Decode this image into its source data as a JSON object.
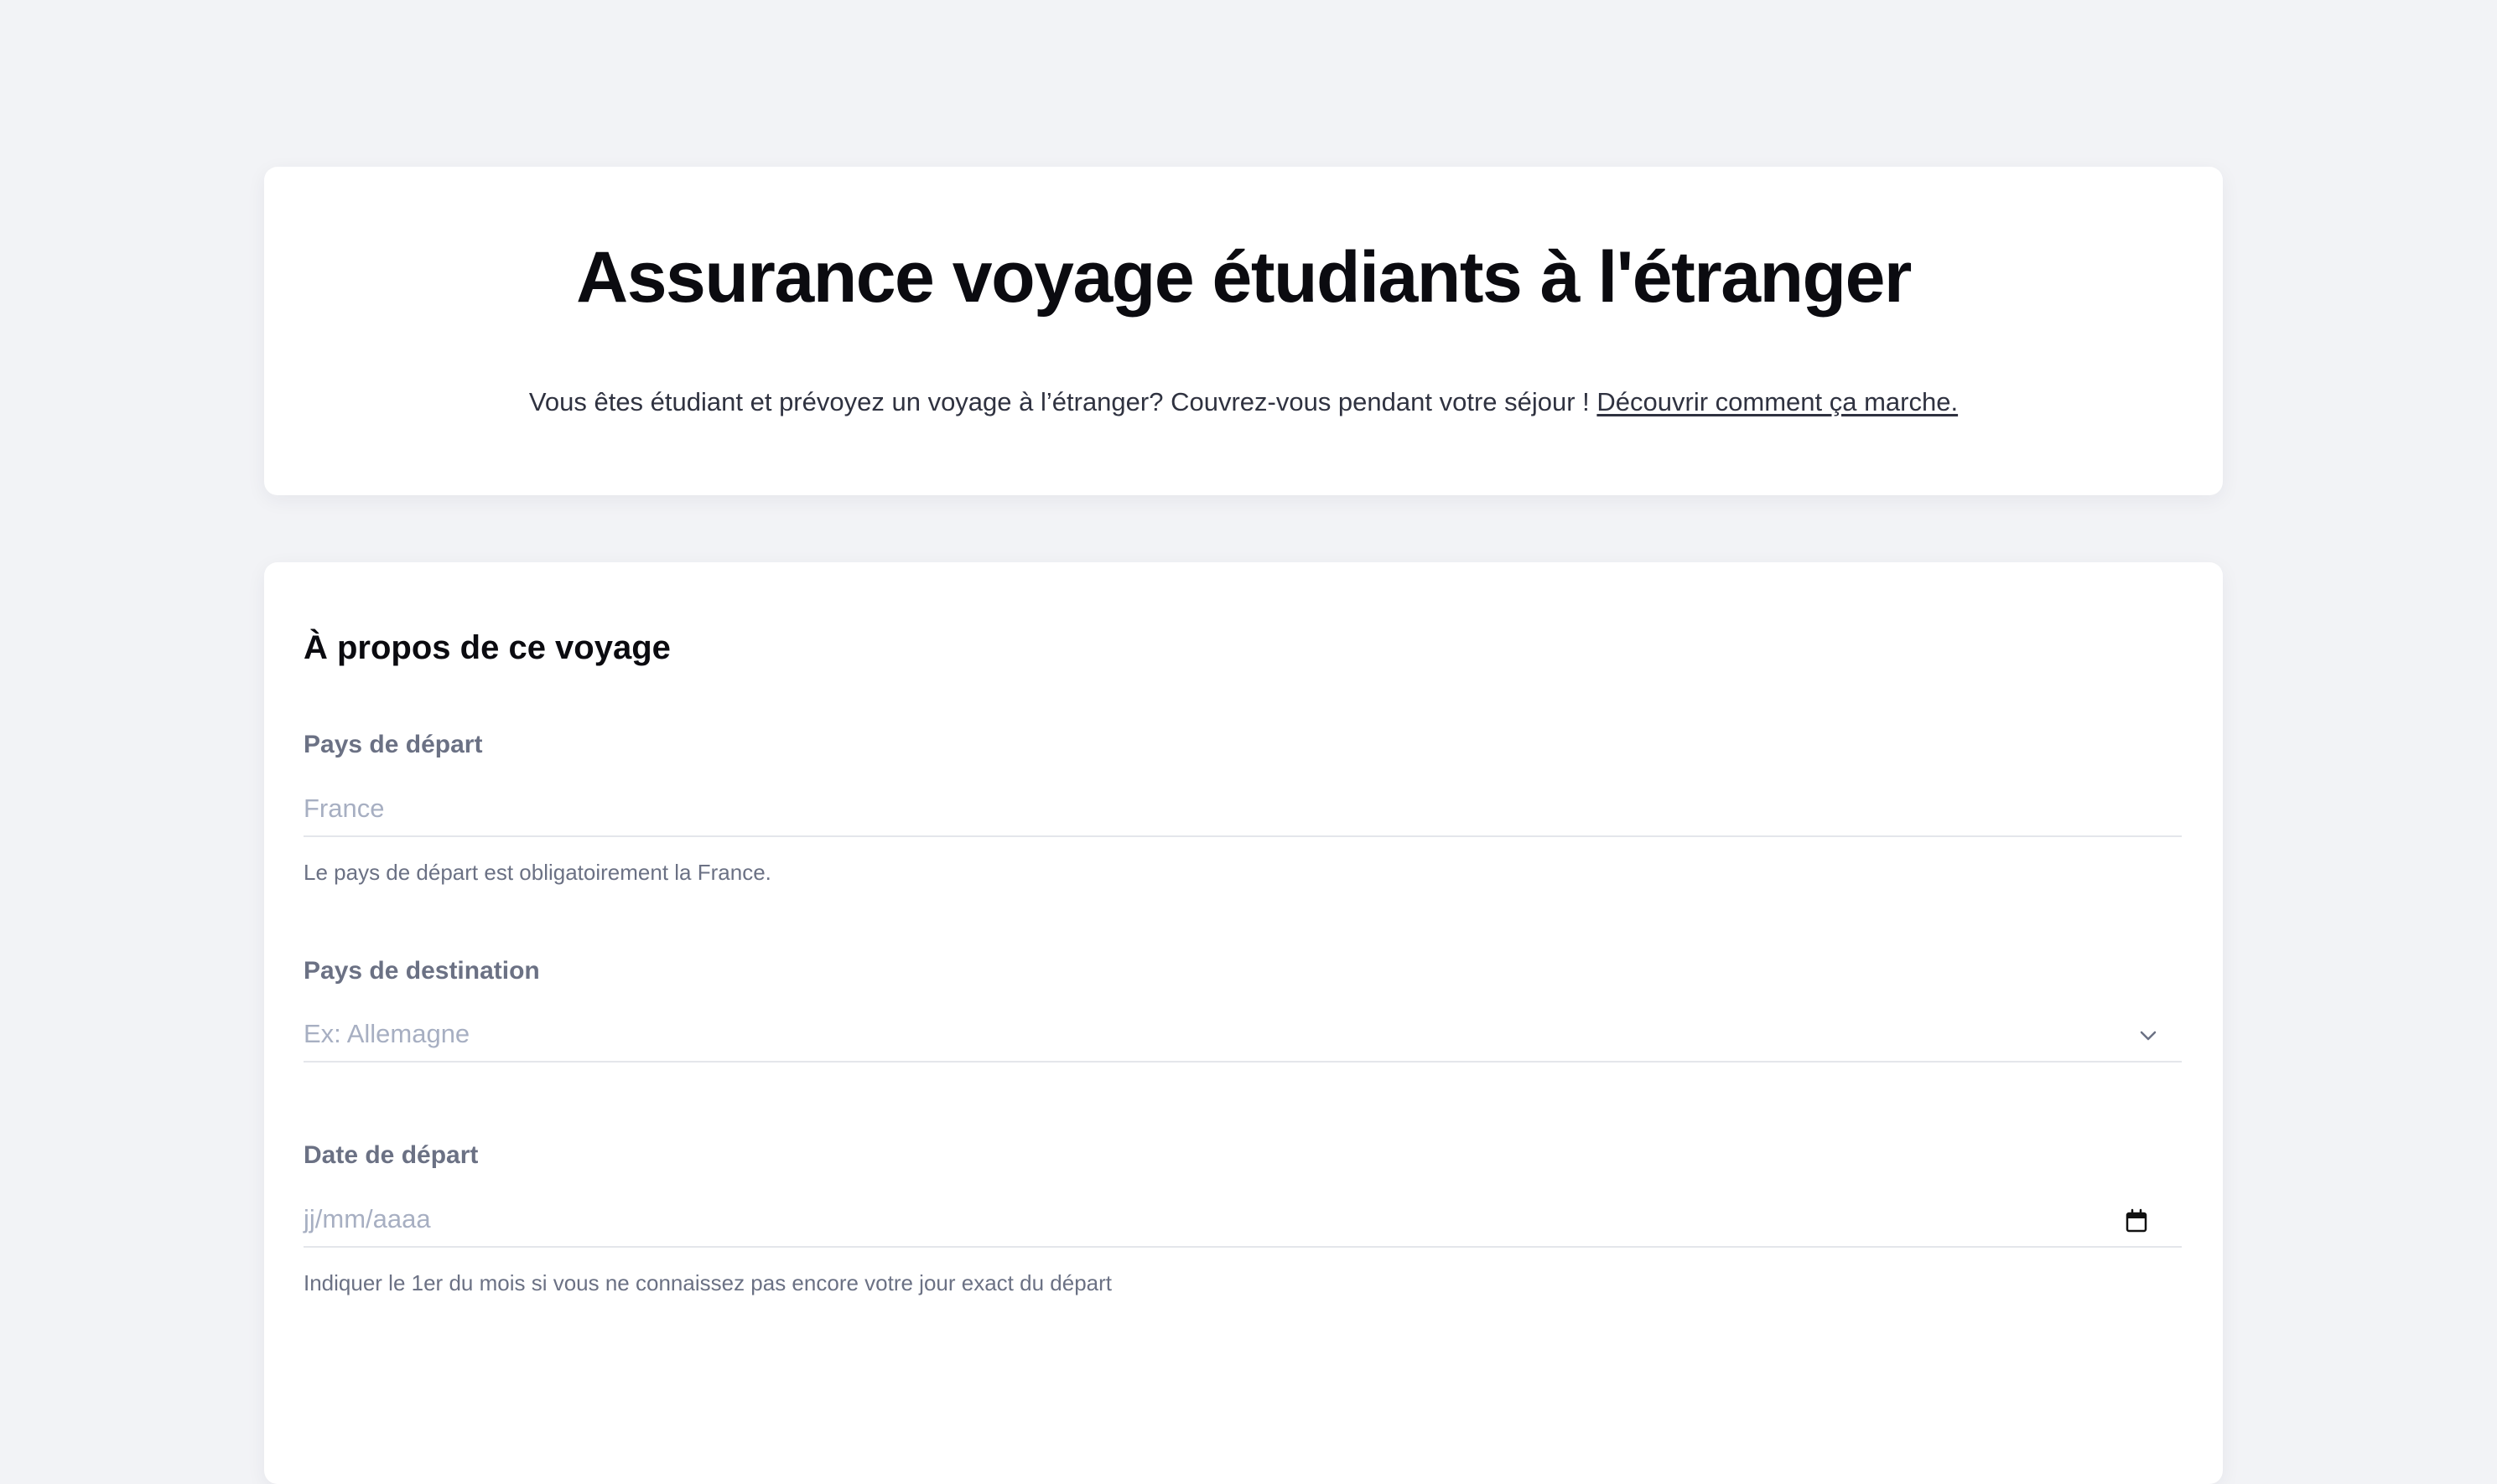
{
  "hero": {
    "title": "Assurance voyage étudiants à l'étranger",
    "subtitle": "Vous êtes étudiant et prévoyez un voyage à l’étranger? Couvrez-vous pendant votre séjour ! ",
    "link_text": "Découvrir comment ça marche."
  },
  "form": {
    "section_title": "À propos de ce voyage",
    "departure_country": {
      "label": "Pays de départ",
      "value": "France",
      "help": "Le pays de départ est obligatoirement la France."
    },
    "destination_country": {
      "label": "Pays de destination",
      "placeholder": "Ex: Allemagne",
      "icon": "chevron-down-icon"
    },
    "departure_date": {
      "label": "Date de départ",
      "placeholder": "jj/mm/aaaa",
      "help": "Indiquer le 1er du mois si vous ne connaissez pas encore votre jour exact du départ",
      "icon": "calendar-icon"
    }
  },
  "colors": {
    "background": "#f2f3f6",
    "card": "#ffffff",
    "title": "#0b0b10",
    "label": "#6b7184",
    "placeholder": "#a7afc2",
    "divider": "#e4e6eb"
  }
}
